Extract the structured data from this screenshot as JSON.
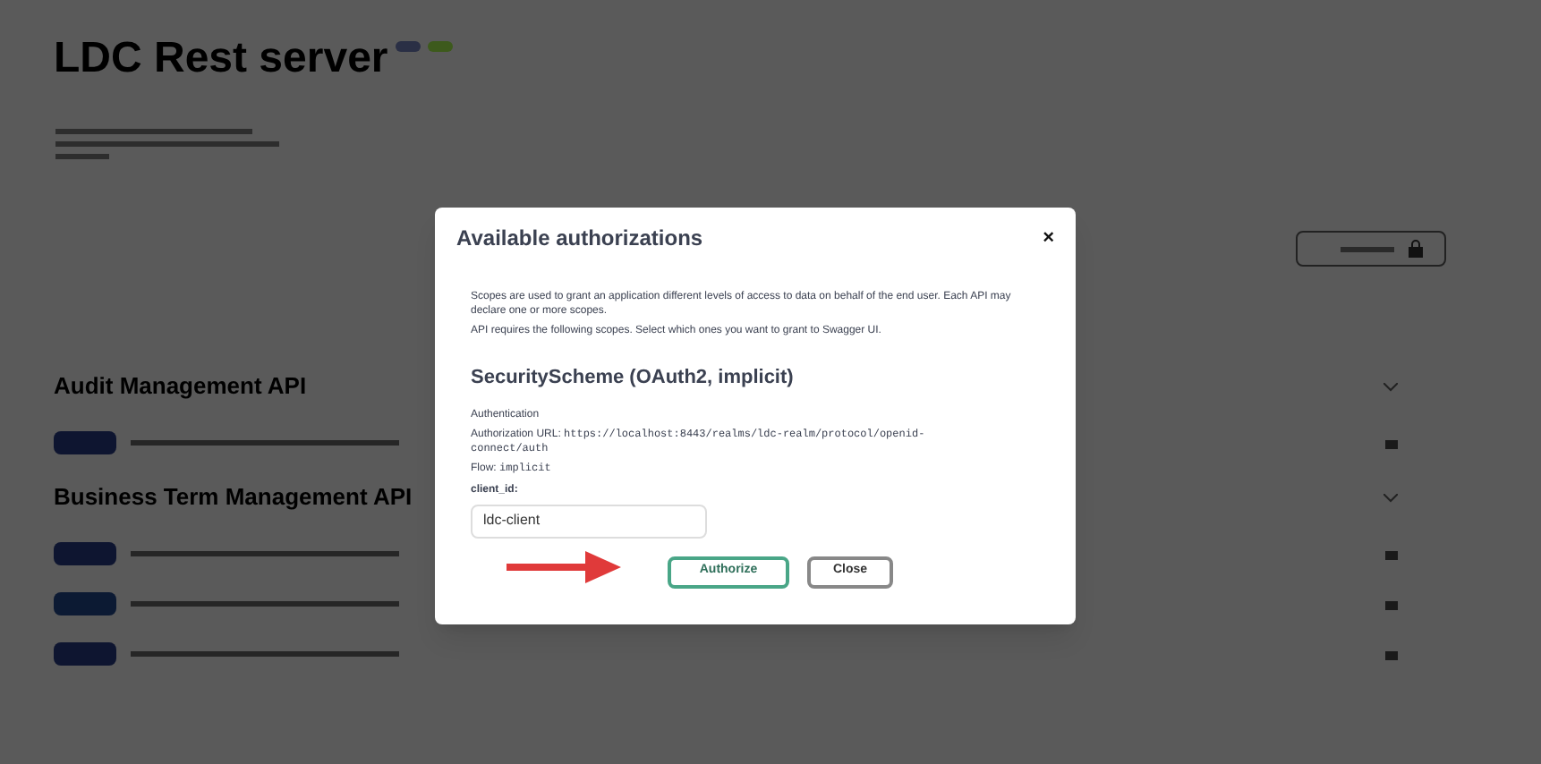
{
  "page": {
    "title": "LDC Rest server",
    "sections": [
      {
        "name": "Audit Management API",
        "operations": [
          {
            "color": "#0e1530"
          }
        ]
      },
      {
        "name": "Business Term Management API",
        "operations": [
          {
            "color": "#0e1530"
          },
          {
            "color": "#0c1a33"
          },
          {
            "color": "#0e1530"
          }
        ]
      }
    ]
  },
  "modal": {
    "title": "Available authorizations",
    "close": "×",
    "paragraphs": [
      "Scopes are used to grant an application different levels of access to data on behalf of the end user. Each API may declare one or more scopes.",
      "API requires the following scopes. Select which ones you want to grant to Swagger UI."
    ],
    "scheme_title": "SecurityScheme (OAuth2, implicit)",
    "section_label": "Authentication",
    "url_label": "Authorization URL:",
    "url": "https://localhost:8443/realms/ldc-realm/protocol/openid-connect/auth",
    "flow_label": "Flow:",
    "flow": "implicit",
    "client_id_label": "client_id:",
    "client_id": "ldc-client",
    "buttons": [
      {
        "label": "Authorize",
        "kind": "primary"
      },
      {
        "label": "Close",
        "kind": "secondary"
      }
    ]
  }
}
